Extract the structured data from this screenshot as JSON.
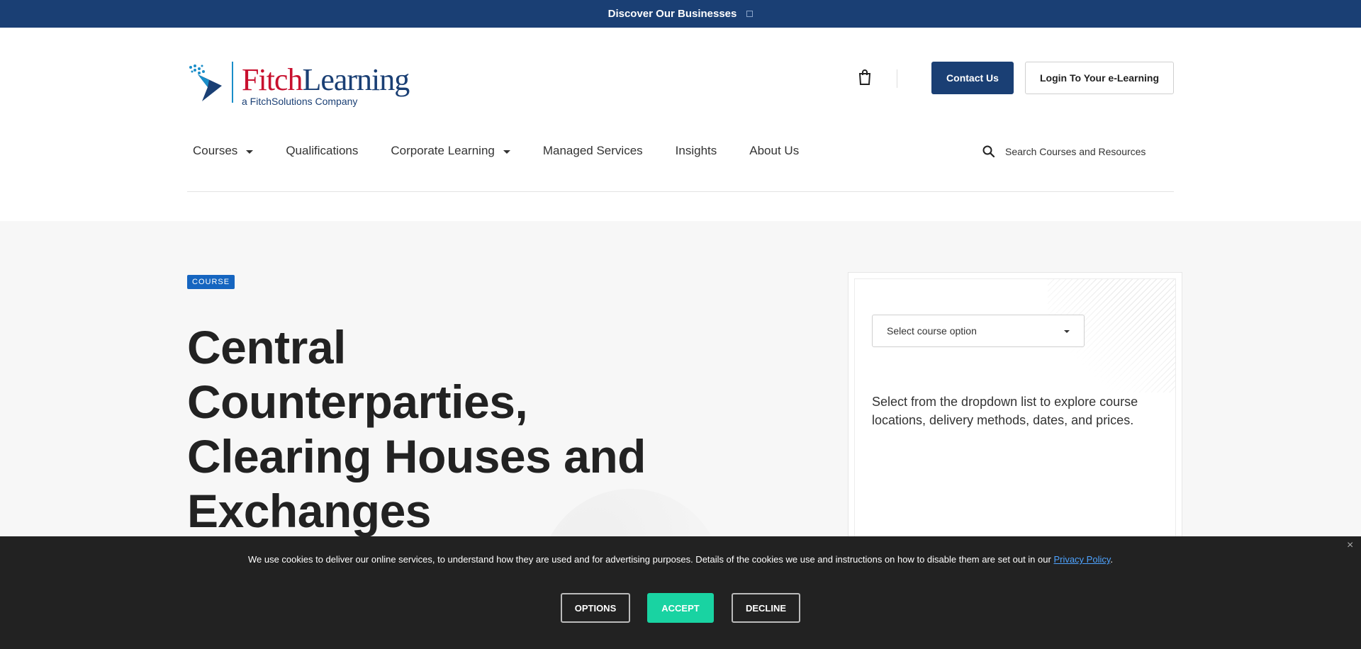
{
  "topbar": {
    "label": "Discover Our Businesses",
    "icon": "chevron-down-icon"
  },
  "header": {
    "logo": {
      "word1": "Fitch",
      "word2": "Learning",
      "tagline": "a FitchSolutions Company",
      "brand_red": "#c8102e",
      "brand_blue": "#1a3f74"
    },
    "cart_icon": "shopping-bag-icon",
    "contact_label": "Contact Us",
    "login_label": "Login To Your e-Learning",
    "accent": "#1a3f74"
  },
  "nav": {
    "items": [
      {
        "label": "Courses",
        "has_dropdown": true
      },
      {
        "label": "Qualifications",
        "has_dropdown": false
      },
      {
        "label": "Corporate Learning",
        "has_dropdown": true
      },
      {
        "label": "Managed Services",
        "has_dropdown": false
      },
      {
        "label": "Insights",
        "has_dropdown": false
      },
      {
        "label": "About Us",
        "has_dropdown": false
      }
    ],
    "search": {
      "placeholder": "Search Courses and Resources",
      "value": "",
      "icon": "search-icon"
    }
  },
  "hero": {
    "badge": "COURSE",
    "badge_color": "#1565c0",
    "title": "Central Counterparties, Clearing Houses and Exchanges"
  },
  "course_card": {
    "select": {
      "selected": "Select course option"
    },
    "description": "Select from the dropdown list to explore course locations, delivery methods, dates, and prices."
  },
  "cookie_banner": {
    "message": "We use cookies to deliver our online services, to understand how they are used and for advertising purposes. Details of the cookies we use and instructions on how to disable them are set out in our",
    "link_text": "Privacy Policy",
    "suffix": ".",
    "options_label": "OPTIONS",
    "accept_label": "ACCEPT",
    "decline_label": "DECLINE",
    "accept_color": "#19d3a2",
    "close_icon": "close-icon"
  }
}
